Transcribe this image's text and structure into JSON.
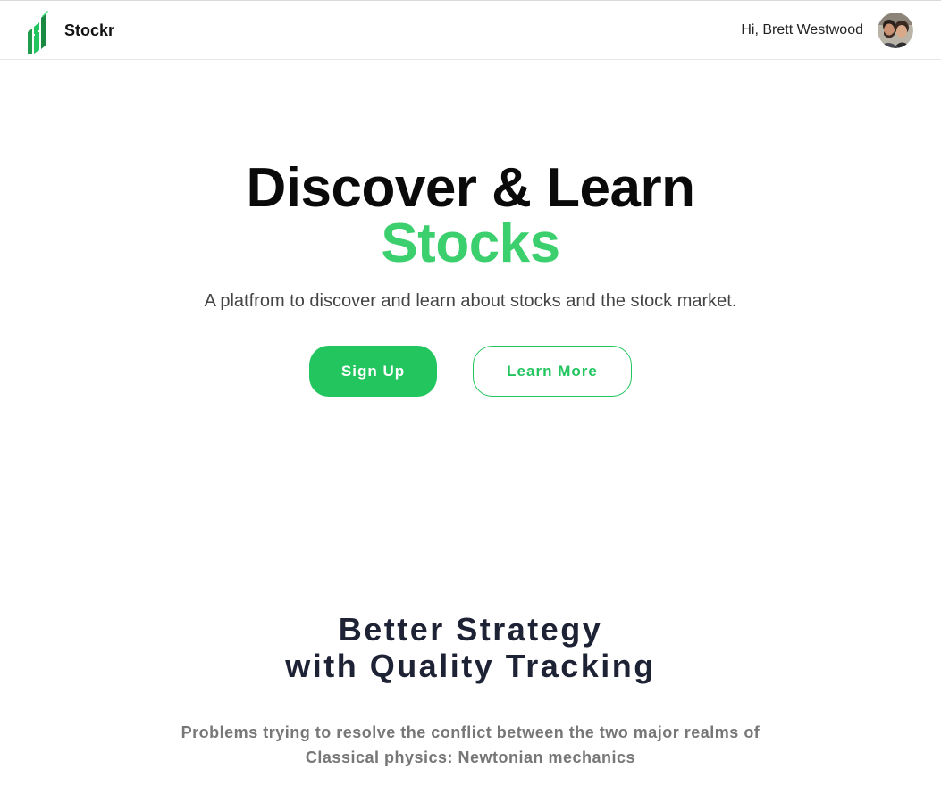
{
  "navbar": {
    "brand_name": "Stockr",
    "logo_icon": "bar-chart-logo-icon",
    "greeting": "Hi, Brett Westwood",
    "avatar_icon": "user-avatar-photo"
  },
  "hero": {
    "title_line1": "Discover & Learn",
    "title_line2": "Stocks",
    "subtitle": "A platfrom to discover and learn about stocks and the stock market.",
    "signup_label": "Sign Up",
    "learn_more_label": "Learn More"
  },
  "features": {
    "title_line1": "Better Strategy",
    "title_line2": "with Quality Tracking",
    "text_line1": "Problems trying to resolve the conflict between the two major realms of",
    "text_line2": "Classical physics: Newtonian mechanics"
  },
  "colors": {
    "accent": "#22c55e",
    "accent_light": "#3ccf6e",
    "heading": "#0a0a0a",
    "section_heading": "#1e2235",
    "muted_text": "#777777"
  }
}
